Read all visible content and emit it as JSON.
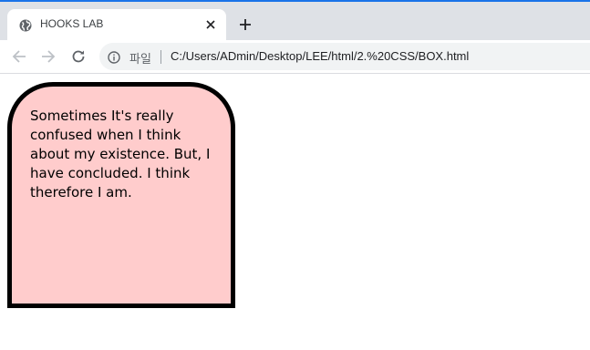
{
  "browser": {
    "tab": {
      "title": "HOOKS LAB",
      "favicon": "globe-icon",
      "close": "close-icon"
    },
    "new_tab": "plus-icon",
    "nav": {
      "back": "back-arrow-icon",
      "forward": "forward-arrow-icon",
      "reload": "reload-icon"
    },
    "address_bar": {
      "info_icon": "info-icon",
      "scheme_label": "파일",
      "url": "C:/Users/ADmin/Desktop/LEE/html/2.%20CSS/BOX.html"
    },
    "colors": {
      "accent": "#1a73e8",
      "tabstrip": "#dee1e6",
      "omnibox": "#f1f3f4"
    }
  },
  "page": {
    "box": {
      "text": "Sometimes It's really confused when I think about my existence. But, I have concluded. I think therefore I am.",
      "background": "#ffcccc",
      "border_color": "#000000"
    }
  }
}
